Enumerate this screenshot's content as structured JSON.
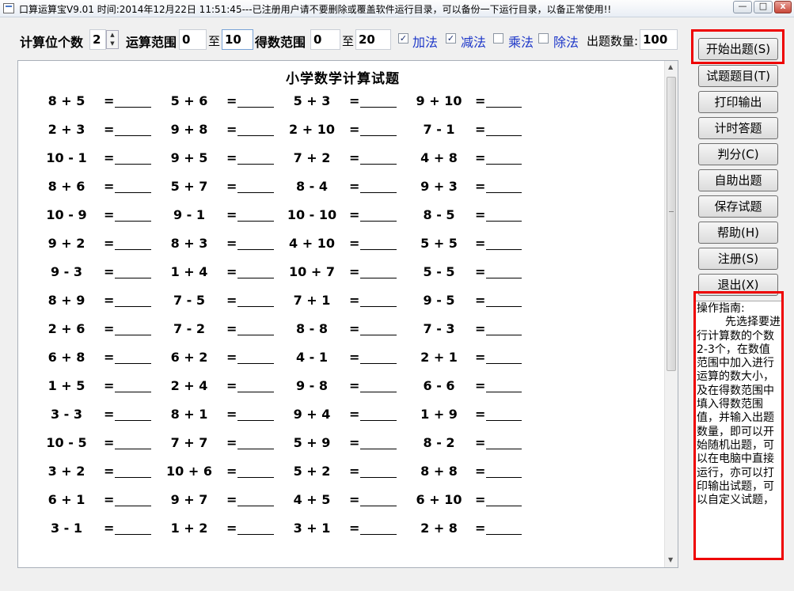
{
  "window": {
    "title": "口算运算宝V9.01  时间:2014年12月22日 11:51:45---已注册用户请不要删除或覆盖软件运行目录，可以备份一下运行目录，以备正常使用!!",
    "minimize": "—",
    "maximize": "□",
    "close": "x"
  },
  "settings": {
    "digit_count_label": "计算位个数",
    "digit_count_value": "2",
    "range_label": "运算范围",
    "range_from": "0",
    "to_1": "至",
    "range_to": "10",
    "result_range_label": "得数范围",
    "result_from": "0",
    "to_2": "至",
    "result_to": "20",
    "add_label": "加法",
    "add_checked": true,
    "sub_label": "减法",
    "sub_checked": true,
    "mul_label": "乘法",
    "mul_checked": false,
    "div_label": "除法",
    "div_checked": false,
    "question_count_label": "出题数量:",
    "question_count_value": "100"
  },
  "sheet": {
    "title": "小学数学计算试题",
    "equals": "=",
    "problems": [
      [
        "8 + 5",
        "5 + 6",
        "5 + 3",
        "9 + 10"
      ],
      [
        "2 + 3",
        "9 + 8",
        "2 + 10",
        "7 - 1"
      ],
      [
        "10 - 1",
        "9 + 5",
        "7 + 2",
        "4 + 8"
      ],
      [
        "8 + 6",
        "5 + 7",
        "8 - 4",
        "9 + 3"
      ],
      [
        "10 - 9",
        "9 - 1",
        "10 - 10",
        "8 - 5"
      ],
      [
        "9 + 2",
        "8 + 3",
        "4 + 10",
        "5 + 5"
      ],
      [
        "9 - 3",
        "1 + 4",
        "10 + 7",
        "5 - 5"
      ],
      [
        "8 + 9",
        "7 - 5",
        "7 + 1",
        "9 - 5"
      ],
      [
        "2 + 6",
        "7 - 2",
        "8 - 8",
        "7 - 3"
      ],
      [
        "6 + 8",
        "6 + 2",
        "4 - 1",
        "2 + 1"
      ],
      [
        "1 + 5",
        "2 + 4",
        "9 - 8",
        "6 - 6"
      ],
      [
        "3 - 3",
        "8 + 1",
        "9 + 4",
        "1 + 9"
      ],
      [
        "10 - 5",
        "7 + 7",
        "5 + 9",
        "8 - 2"
      ],
      [
        "3 + 2",
        "10 + 6",
        "5 + 2",
        "8 + 8"
      ],
      [
        "6 + 1",
        "9 + 7",
        "4 + 5",
        "6 + 10"
      ],
      [
        "3 - 1",
        "1 + 2",
        "3 + 1",
        "2 + 8"
      ]
    ]
  },
  "buttons": [
    "开始出题(S)",
    "试题题目(T)",
    "打印输出",
    "计时答题",
    "判分(C)",
    "自助出题",
    "保存试题",
    "帮助(H)",
    "注册(S)",
    "退出(X)"
  ],
  "guide": {
    "title": "操作指南:",
    "body": "先选择要进行计算数的个数2-3个，在数值范围中加入进行运算的数大小，及在得数范围中填入得数范围值，并输入出题数量，即可以开始随机出题，可以在电脑中直接运行，亦可以打印输出试题，可以自定义试题，"
  },
  "colors": {
    "highlight": "#e00000",
    "op_label_blue": "#1c36c8"
  }
}
